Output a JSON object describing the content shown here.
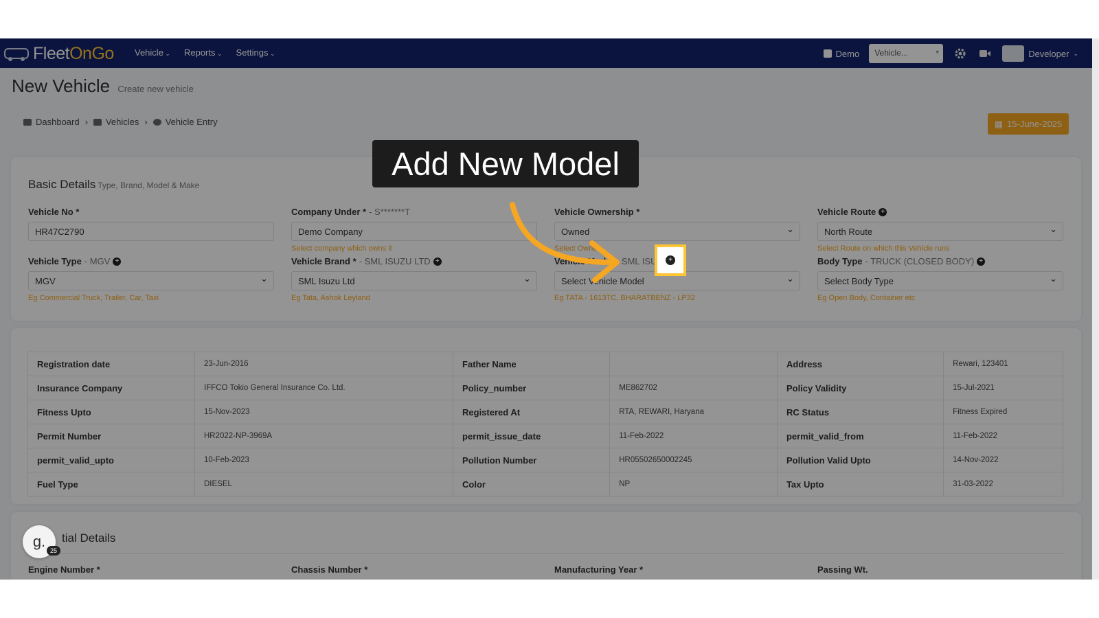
{
  "navbar": {
    "logo_text_a": "Fleet",
    "logo_text_b": "OnGo",
    "menu": [
      "Vehicle",
      "Reports",
      "Settings"
    ],
    "demo_label": "Demo",
    "vehicle_select": "Vehicle...",
    "user_name": "Developer"
  },
  "header": {
    "title": "New Vehicle",
    "subtitle": "Create new vehicle",
    "breadcrumb": [
      "Dashboard",
      "Vehicles",
      "Vehicle Entry"
    ],
    "date": "15-June-2025"
  },
  "basic": {
    "title": "Basic Details",
    "subtitle": "Type, Brand, Model & Make",
    "fields": {
      "vehicle_no": {
        "label": "Vehicle No *",
        "value": "HR47C2790"
      },
      "company": {
        "label": "Company Under *",
        "extra": "- S*******T",
        "value": "Demo Company",
        "help": "Select company which owns it"
      },
      "ownership": {
        "label": "Vehicle Ownership *",
        "value": "Owned",
        "help": "Select Owner"
      },
      "route": {
        "label": "Vehicle Route",
        "value": "North Route",
        "help": "Select Route on which this Vehicle runs"
      },
      "type": {
        "label": "Vehicle Type",
        "extra": "- MGV",
        "value": "MGV",
        "help": "Eg Commercial Truck, Trailer, Car, Taxi"
      },
      "brand": {
        "label": "Vehicle Brand *",
        "extra": "- SML ISUZU LTD",
        "value": "SML Isuzu Ltd",
        "help": "Eg Tata, Ashok Leyland"
      },
      "model": {
        "label": "Vehicle Model",
        "extra": "- SML ISUZU",
        "value": "Select Vehicle Model",
        "help": "Eg TATA - 1613TC, BHARATBENZ - LP32"
      },
      "body": {
        "label": "Body Type",
        "extra": "- TRUCK (CLOSED BODY)",
        "value": "Select Body Type",
        "help": "Eg Open Body, Container etc"
      }
    }
  },
  "rc": {
    "rows": [
      [
        "Registration date",
        "23-Jun-2016",
        "Father Name",
        "",
        "Address",
        "Rewari, 123401"
      ],
      [
        "Insurance Company",
        "IFFCO Tokio General Insurance Co. Ltd.",
        "Policy_number",
        "ME862702",
        "Policy Validity",
        "15-Jul-2021"
      ],
      [
        "Fitness Upto",
        "15-Nov-2023",
        "Registered At",
        "RTA, REWARI, Haryana",
        "RC Status",
        "Fitness Expired"
      ],
      [
        "Permit Number",
        "HR2022-NP-3969A",
        "permit_issue_date",
        "11-Feb-2022",
        "permit_valid_from",
        "11-Feb-2022"
      ],
      [
        "permit_valid_upto",
        "10-Feb-2023",
        "Pollution Number",
        "HR05502650002245",
        "Pollution Valid Upto",
        "14-Nov-2022"
      ],
      [
        "Fuel Type",
        "DIESEL",
        "Color",
        "NP",
        "Tax Upto",
        "31-03-2022"
      ]
    ]
  },
  "tech": {
    "title_visible": "tial Details",
    "fields": [
      "Engine Number *",
      "Chassis Number *",
      "Manufacturing Year *",
      "Passing Wt."
    ]
  },
  "tour": {
    "tooltip": "Add New Model",
    "bubble_letter": "g.",
    "bubble_count": "25",
    "highlight_color": "#ffc533"
  }
}
